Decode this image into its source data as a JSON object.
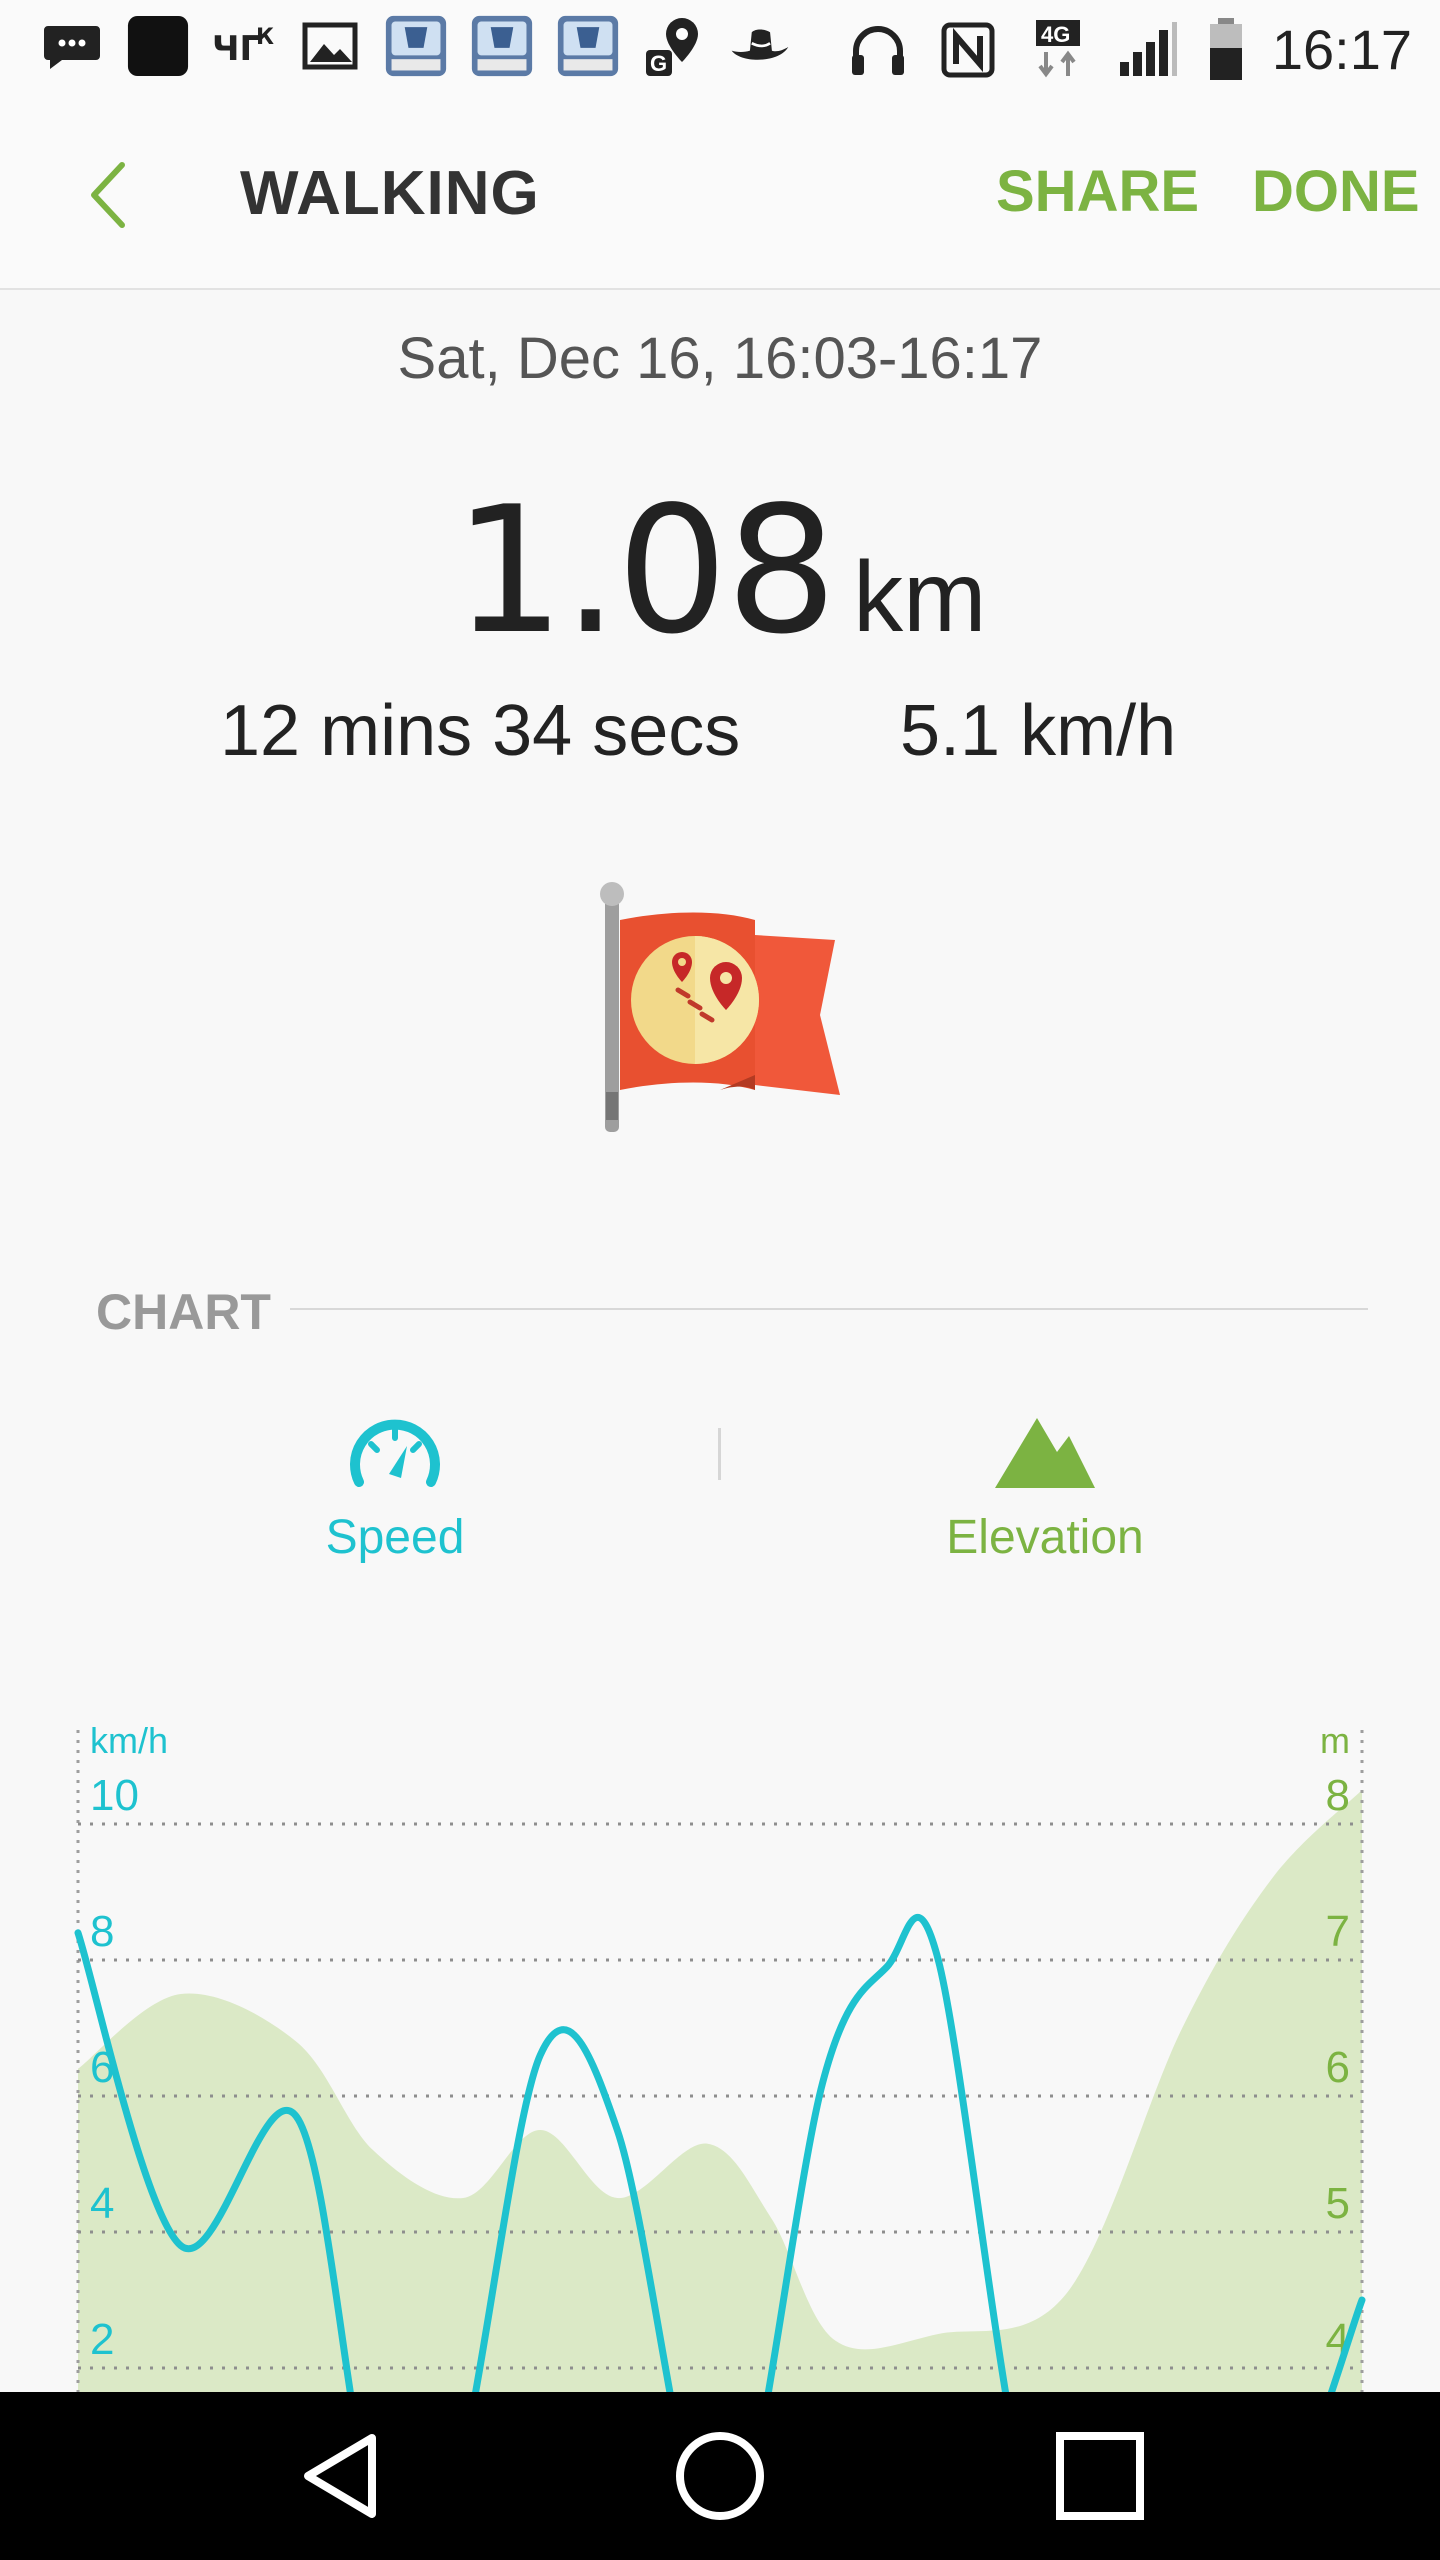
{
  "status_bar": {
    "time": "16:17",
    "network_label": "4G",
    "left_icons": [
      "messages-icon",
      "app-icon",
      "carrier-icon",
      "gallery-icon",
      "app-badge-icon",
      "app-badge-icon",
      "app-badge-icon",
      "location-icon",
      "cowboy-hat-icon"
    ],
    "right_icons": [
      "headphones-icon",
      "nfc-icon",
      "network-4g-icon",
      "signal-icon",
      "battery-icon"
    ]
  },
  "app_bar": {
    "title": "WALKING",
    "share_label": "SHARE",
    "done_label": "DONE"
  },
  "summary": {
    "date_range": "Sat, Dec 16, 16:03-16:17",
    "distance_value": "1.08",
    "distance_unit": "km",
    "duration": "12 mins 34 secs",
    "avg_speed": "5.1 km/h"
  },
  "chart_section": {
    "header": "CHART",
    "tabs": [
      {
        "label": "Speed",
        "icon": "speedometer-icon",
        "color": "#1ec2cf"
      },
      {
        "label": "Elevation",
        "icon": "mountain-icon",
        "color": "#7cb342"
      }
    ]
  },
  "colors": {
    "accent_green": "#7cb342",
    "speed_line": "#1ec2cf",
    "elevation_fill": "#dbe9c6",
    "flag_red": "#f0583a"
  },
  "chart_data": {
    "type": "line",
    "left_axis": {
      "unit": "km/h",
      "ticks": [
        10,
        8,
        6,
        4,
        2
      ],
      "color": "#1ec2cf"
    },
    "right_axis": {
      "unit": "m",
      "ticks": [
        8,
        7,
        6,
        5,
        4
      ],
      "color": "#7cb342"
    },
    "grid": true,
    "series": [
      {
        "name": "Speed",
        "axis": "left",
        "style": "line",
        "color": "#1ec2cf",
        "x": [
          0,
          0.08,
          0.17,
          0.23,
          0.29,
          0.36,
          0.42,
          0.48,
          0.52,
          0.58,
          0.63,
          0.67,
          0.74,
          0.8,
          0.88,
          0.94,
          1.0
        ],
        "y": [
          8.4,
          3.8,
          5.7,
          0.0,
          0.0,
          6.6,
          5.5,
          0.0,
          0.0,
          6.2,
          7.9,
          8.0,
          0.0,
          0.0,
          0.0,
          0.0,
          3.0
        ]
      },
      {
        "name": "Elevation",
        "axis": "right",
        "style": "area",
        "color": "#dbe9c6",
        "x": [
          0,
          0.08,
          0.17,
          0.23,
          0.3,
          0.36,
          0.42,
          0.49,
          0.54,
          0.59,
          0.67,
          0.77,
          0.86,
          0.93,
          1.0
        ],
        "y": [
          6.2,
          6.75,
          6.4,
          5.6,
          5.25,
          5.75,
          5.25,
          5.65,
          5.1,
          4.2,
          4.25,
          4.55,
          6.5,
          7.6,
          8.25
        ]
      }
    ]
  }
}
